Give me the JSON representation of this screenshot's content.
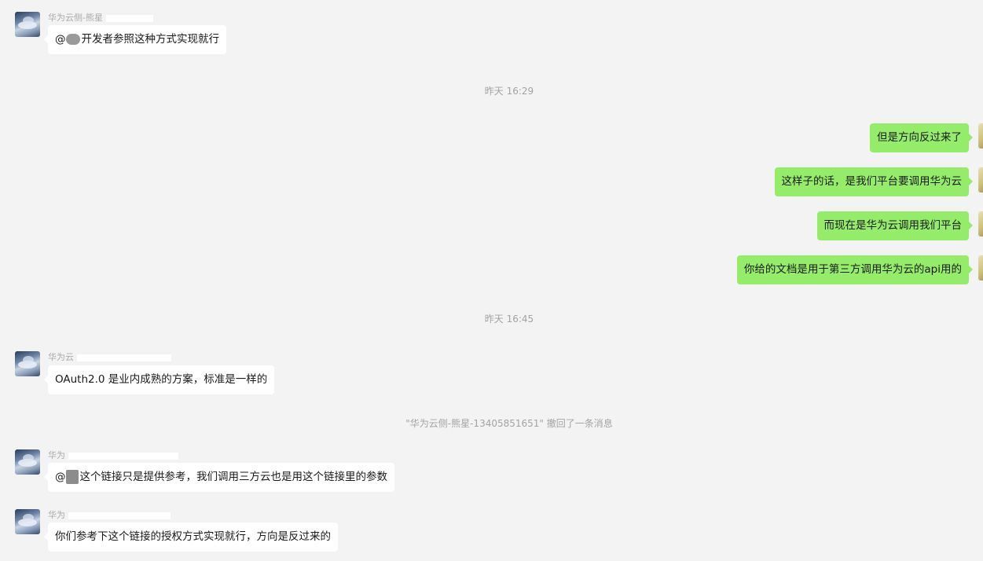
{
  "messages_top": {
    "sender": "华为云侧-熊星",
    "text": "开发者参照这种方式实现就行",
    "mention": "@"
  },
  "timestamps": {
    "first": "昨天 16:29",
    "second": "昨天 16:45"
  },
  "outgoing": [
    {
      "text": "但是方向反过来了"
    },
    {
      "text": "这样子的话，是我们平台要调用华为云"
    },
    {
      "text": "而现在是华为云调用我们平台"
    },
    {
      "text": "你给的文档是用于第三方调用华为云的api用的"
    }
  ],
  "incoming": [
    {
      "sender": "华为云",
      "text": "OAuth2.0 是业内成熟的方案，标准是一样的"
    },
    {
      "sender": "华为",
      "mention": "@",
      "text": "这个链接只是提供参考，我们调用三方云也是用这个链接里的参数"
    },
    {
      "sender": "华为",
      "text": "你们参考下这个链接的授权方式实现就行，方向是反过来的"
    }
  ],
  "system_notice": "\"华为云侧-熊星-13405851651\" 撤回了一条消息",
  "colors": {
    "background": "#f3f3f3",
    "outgoing_bubble": "#95ec69",
    "incoming_bubble": "#ffffff",
    "meta_text": "#a3a3a3"
  }
}
